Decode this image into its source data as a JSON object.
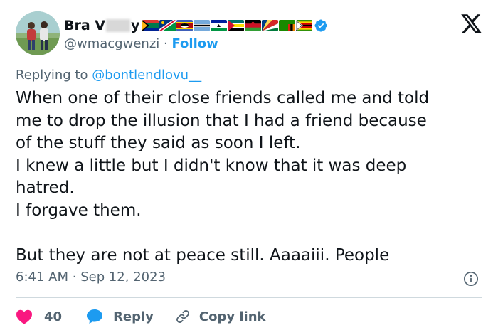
{
  "author": {
    "display_name_start": "Bra V",
    "display_name_end": "y",
    "handle": "@wmacgwenzi",
    "separator": "·",
    "follow_label": "Follow",
    "flag_icons": [
      "south-africa-flag-icon",
      "namibia-flag-icon",
      "eswatini-flag-icon",
      "botswana-flag-icon",
      "lesotho-flag-icon",
      "mozambique-flag-icon",
      "malawi-flag-icon",
      "seychelles-flag-icon",
      "zambia-flag-icon",
      "zimbabwe-flag-icon"
    ],
    "verified_icon": "verified-badge-icon"
  },
  "reply_context": {
    "prefix": "Replying to ",
    "mention": "@bontlendlovu__"
  },
  "tweet": {
    "lines": [
      "When one of their close friends called me and told",
      "me to drop the illusion that I had a friend because",
      "of the stuff they said as soon I left.",
      "I knew a little but I didn't know that it was deep",
      "hatred.",
      "I forgave them.",
      "",
      "But they are not at peace still. Aaaaiii. People"
    ],
    "time": "6:41 AM",
    "separator": "·",
    "date": "Sep 12, 2023"
  },
  "actions": {
    "like_count": "40",
    "reply_label": "Reply",
    "copy_label": "Copy link"
  },
  "colors": {
    "accent": "#1d9bf0",
    "like": "#f91880",
    "muted": "#536471",
    "text": "#0f1419"
  }
}
